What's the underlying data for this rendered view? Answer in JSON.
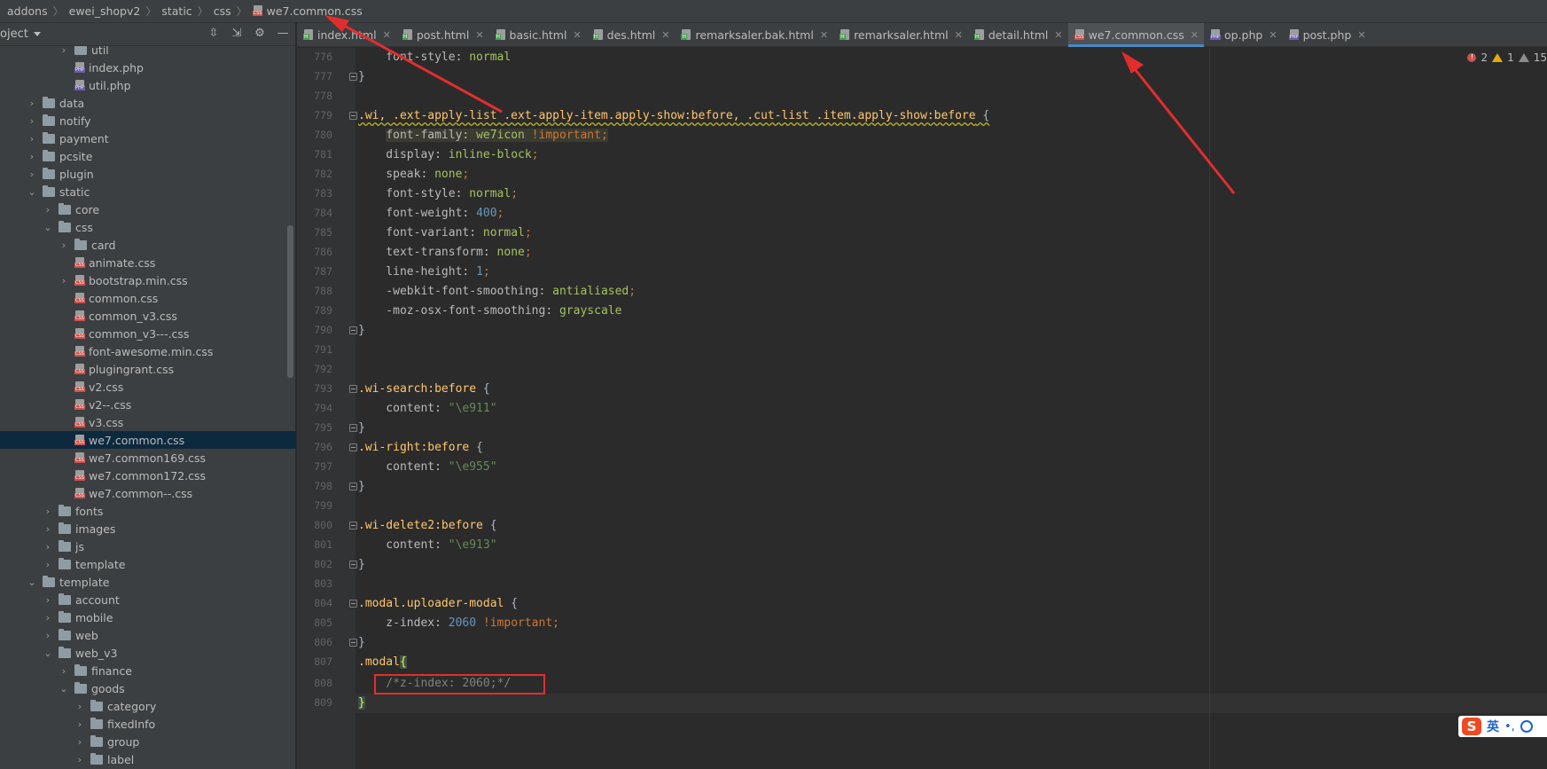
{
  "breadcrumb": {
    "items": [
      "addons",
      "ewei_shopv2",
      "static",
      "css",
      "we7.common.css"
    ]
  },
  "project": {
    "title": "oject",
    "tree": [
      {
        "label": "util",
        "type": "folder",
        "depth": 3,
        "expanded": false
      },
      {
        "label": "index.php",
        "type": "php",
        "depth": 3
      },
      {
        "label": "util.php",
        "type": "php",
        "depth": 3
      },
      {
        "label": "data",
        "type": "folder",
        "depth": 1,
        "expanded": false
      },
      {
        "label": "notify",
        "type": "folder",
        "depth": 1,
        "expanded": false
      },
      {
        "label": "payment",
        "type": "folder",
        "depth": 1,
        "expanded": false
      },
      {
        "label": "pcsite",
        "type": "folder",
        "depth": 1,
        "expanded": false
      },
      {
        "label": "plugin",
        "type": "folder",
        "depth": 1,
        "expanded": false
      },
      {
        "label": "static",
        "type": "folder",
        "depth": 1,
        "expanded": true
      },
      {
        "label": "core",
        "type": "folder",
        "depth": 2,
        "expanded": false
      },
      {
        "label": "css",
        "type": "folder",
        "depth": 2,
        "expanded": true
      },
      {
        "label": "card",
        "type": "folder",
        "depth": 3,
        "expanded": false
      },
      {
        "label": "animate.css",
        "type": "css",
        "depth": 3
      },
      {
        "label": "bootstrap.min.css",
        "type": "css",
        "depth": 3,
        "expanded": false
      },
      {
        "label": "common.css",
        "type": "css",
        "depth": 3
      },
      {
        "label": "common_v3.css",
        "type": "css",
        "depth": 3
      },
      {
        "label": "common_v3---.css",
        "type": "css",
        "depth": 3
      },
      {
        "label": "font-awesome.min.css",
        "type": "css",
        "depth": 3
      },
      {
        "label": "plugingrant.css",
        "type": "css",
        "depth": 3
      },
      {
        "label": "v2.css",
        "type": "css",
        "depth": 3
      },
      {
        "label": "v2--.css",
        "type": "css",
        "depth": 3
      },
      {
        "label": "v3.css",
        "type": "css",
        "depth": 3
      },
      {
        "label": "we7.common.css",
        "type": "css",
        "depth": 3,
        "selected": true
      },
      {
        "label": "we7.common169.css",
        "type": "css",
        "depth": 3
      },
      {
        "label": "we7.common172.css",
        "type": "css",
        "depth": 3
      },
      {
        "label": "we7.common--.css",
        "type": "css",
        "depth": 3
      },
      {
        "label": "fonts",
        "type": "folder",
        "depth": 2,
        "expanded": false
      },
      {
        "label": "images",
        "type": "folder",
        "depth": 2,
        "expanded": false
      },
      {
        "label": "js",
        "type": "folder",
        "depth": 2,
        "expanded": false
      },
      {
        "label": "template",
        "type": "folder",
        "depth": 2,
        "expanded": false
      },
      {
        "label": "template",
        "type": "folder",
        "depth": 1,
        "expanded": true
      },
      {
        "label": "account",
        "type": "folder",
        "depth": 2,
        "expanded": false
      },
      {
        "label": "mobile",
        "type": "folder",
        "depth": 2,
        "expanded": false
      },
      {
        "label": "web",
        "type": "folder",
        "depth": 2,
        "expanded": false
      },
      {
        "label": "web_v3",
        "type": "folder",
        "depth": 2,
        "expanded": true
      },
      {
        "label": "finance",
        "type": "folder",
        "depth": 3,
        "expanded": false
      },
      {
        "label": "goods",
        "type": "folder",
        "depth": 3,
        "expanded": true
      },
      {
        "label": "category",
        "type": "folder",
        "depth": 4,
        "expanded": false
      },
      {
        "label": "fixedInfo",
        "type": "folder",
        "depth": 4,
        "expanded": false
      },
      {
        "label": "group",
        "type": "folder",
        "depth": 4,
        "expanded": false
      },
      {
        "label": "label",
        "type": "folder",
        "depth": 4,
        "expanded": false
      }
    ]
  },
  "tabs": [
    {
      "label": "index.html",
      "type": "html",
      "active": false
    },
    {
      "label": "post.html",
      "type": "html",
      "active": false
    },
    {
      "label": "basic.html",
      "type": "html",
      "active": false
    },
    {
      "label": "des.html",
      "type": "html",
      "active": false
    },
    {
      "label": "remarksaler.bak.html",
      "type": "html",
      "active": false
    },
    {
      "label": "remarksaler.html",
      "type": "html",
      "active": false
    },
    {
      "label": "detail.html",
      "type": "html",
      "active": false
    },
    {
      "label": "we7.common.css",
      "type": "css",
      "active": true
    },
    {
      "label": "op.php",
      "type": "php",
      "active": false
    },
    {
      "label": "post.php",
      "type": "php",
      "active": false
    }
  ],
  "problems": {
    "errors": "2",
    "warnings": "1",
    "weak": "15"
  },
  "editor": {
    "lines": [
      {
        "n": "776",
        "fold": false
      },
      {
        "n": "777",
        "fold": true
      },
      {
        "n": "778",
        "fold": false
      },
      {
        "n": "779",
        "fold": true
      },
      {
        "n": "780",
        "fold": false
      },
      {
        "n": "781",
        "fold": false
      },
      {
        "n": "782",
        "fold": false
      },
      {
        "n": "783",
        "fold": false
      },
      {
        "n": "784",
        "fold": false
      },
      {
        "n": "785",
        "fold": false
      },
      {
        "n": "786",
        "fold": false
      },
      {
        "n": "787",
        "fold": false
      },
      {
        "n": "788",
        "fold": false
      },
      {
        "n": "789",
        "fold": false
      },
      {
        "n": "790",
        "fold": true
      },
      {
        "n": "791",
        "fold": false
      },
      {
        "n": "792",
        "fold": false
      },
      {
        "n": "793",
        "fold": true
      },
      {
        "n": "794",
        "fold": false
      },
      {
        "n": "795",
        "fold": true
      },
      {
        "n": "796",
        "fold": true
      },
      {
        "n": "797",
        "fold": false
      },
      {
        "n": "798",
        "fold": true
      },
      {
        "n": "799",
        "fold": false
      },
      {
        "n": "800",
        "fold": true
      },
      {
        "n": "801",
        "fold": false
      },
      {
        "n": "802",
        "fold": true
      },
      {
        "n": "803",
        "fold": false
      },
      {
        "n": "804",
        "fold": true
      },
      {
        "n": "805",
        "fold": false
      },
      {
        "n": "806",
        "fold": true
      },
      {
        "n": "807",
        "fold": false
      },
      {
        "n": "808",
        "fold": false
      },
      {
        "n": "809",
        "fold": false
      }
    ],
    "code": {
      "l776a": "    font-style: ",
      "l776b": "normal",
      "l777": "}",
      "l779a": ".wi, .ext-apply-list .ext-apply-item.apply-show:before, .cut-list .item.apply-show:before",
      "l779b": " {",
      "l780a": "font-family: ",
      "l780b": "we7icon",
      "l780c": " !important",
      "l780d": ";",
      "l781a": "    display: ",
      "l781b": "inline-block",
      "l781c": ";",
      "l782a": "    speak: ",
      "l782b": "none",
      "l782c": ";",
      "l783a": "    font-style: ",
      "l783b": "normal",
      "l783c": ";",
      "l784a": "    font-weight: ",
      "l784b": "400",
      "l784c": ";",
      "l785a": "    font-variant: ",
      "l785b": "normal",
      "l785c": ";",
      "l786a": "    text-transform: ",
      "l786b": "none",
      "l786c": ";",
      "l787a": "    line-height: ",
      "l787b": "1",
      "l787c": ";",
      "l788a": "    -webkit-font-smoothing: ",
      "l788b": "antialiased",
      "l788c": ";",
      "l789a": "    -moz-osx-font-smoothing: ",
      "l789b": "grayscale",
      "l790": "}",
      "l793a": ".wi-search:before",
      "l793b": " {",
      "l794a": "    content: ",
      "l794b": "\"\\e911\"",
      "l795": "}",
      "l796a": ".wi-right:before",
      "l796b": " {",
      "l797a": "    content: ",
      "l797b": "\"\\e955\"",
      "l798": "}",
      "l800a": ".wi-delete2:before",
      "l800b": " {",
      "l801a": "    content: ",
      "l801b": "\"\\e913\"",
      "l802": "}",
      "l804a": ".modal.uploader-modal",
      "l804b": " {",
      "l805a": "    z-index: ",
      "l805b": "2060",
      "l805c": " !important",
      "l805d": ";",
      "l806": "}",
      "l807a": ".modal",
      "l807b": "{",
      "l808": "    /*z-index: 2060;*/",
      "l809": "}"
    }
  },
  "ime": {
    "lang": "英",
    "punct": "•,",
    "logo": "S"
  },
  "colors": {
    "accent": "#4a88c7",
    "annotation": "#e32d2d",
    "selection": "#0d293e"
  }
}
